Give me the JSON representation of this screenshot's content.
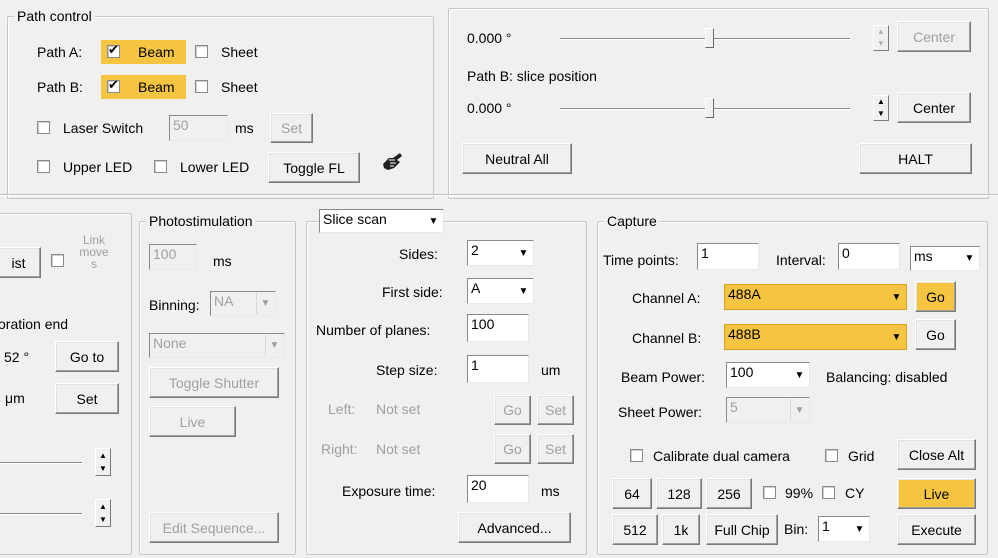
{
  "path_control": {
    "title": "Path control",
    "path_a_label": "Path A:",
    "path_b_label": "Path B:",
    "beam_label": "Beam",
    "sheet_label": "Sheet",
    "laser_switch_label": "Laser Switch",
    "laser_switch_value": "50",
    "laser_switch_unit": "ms",
    "set_label": "Set",
    "upper_led_label": "Upper LED",
    "lower_led_label": "Lower LED",
    "toggle_fl_label": "Toggle FL"
  },
  "slice_panel": {
    "path_a_value": "0.000 °",
    "path_b_title": "Path B: slice position",
    "path_b_value": "0.000 °",
    "center_label": "Center",
    "neutral_all_label": "Neutral All",
    "halt_label": "HALT"
  },
  "left_partial": {
    "btn_partial": "ist",
    "link_move_label": "Link\nmove\ns",
    "oration_end": "oration end",
    "value_52": "52 °",
    "go_to_label": "Go to",
    "um_label": "μm",
    "set_label": "Set"
  },
  "photostim": {
    "title": "Photostimulation",
    "ms_value": "100",
    "ms_unit": "ms",
    "binning_label": "Binning:",
    "binning_value": "NA",
    "none_value": "None",
    "toggle_shutter_label": "Toggle Shutter",
    "live_label": "Live",
    "edit_sequence_label": "Edit Sequence..."
  },
  "scan": {
    "mode_value": "Slice scan",
    "sides_label": "Sides:",
    "sides_value": "2",
    "first_side_label": "First side:",
    "first_side_value": "A",
    "num_planes_label": "Number of planes:",
    "num_planes_value": "100",
    "step_size_label": "Step size:",
    "step_size_value": "1",
    "step_size_unit": "um",
    "left_label": "Left:",
    "left_value": "Not set",
    "right_label": "Right:",
    "right_value": "Not set",
    "go_label": "Go",
    "set_label": "Set",
    "exposure_label": "Exposure time:",
    "exposure_value": "20",
    "exposure_unit": "ms",
    "advanced_label": "Advanced..."
  },
  "capture": {
    "title": "Capture",
    "time_points_label": "Time points:",
    "time_points_value": "1",
    "interval_label": "Interval:",
    "interval_value": "0",
    "interval_unit": "ms",
    "channel_a_label": "Channel A:",
    "channel_a_value": "488A",
    "channel_b_label": "Channel B:",
    "channel_b_value": "488B",
    "go_label": "Go",
    "beam_power_label": "Beam Power:",
    "beam_power_value": "100",
    "balancing_label": "Balancing: disabled",
    "sheet_power_label": "Sheet Power:",
    "sheet_power_value": "5",
    "calibrate_label": "Calibrate dual camera",
    "grid_label": "Grid",
    "close_alt_label": "Close Alt",
    "btn_64": "64",
    "btn_128": "128",
    "btn_256": "256",
    "pct_label": "99%",
    "cy_label": "CY",
    "live_label": "Live",
    "btn_512": "512",
    "btn_1k": "1k",
    "full_chip_label": "Full Chip",
    "bin_label": "Bin:",
    "bin_value": "1",
    "execute_label": "Execute"
  },
  "colors": {
    "highlight": "#f5c542",
    "background": "#f0f0f0"
  }
}
